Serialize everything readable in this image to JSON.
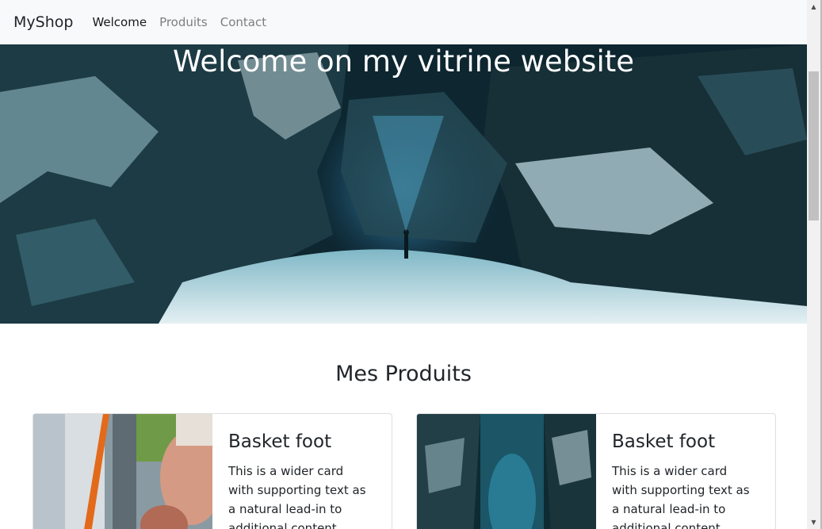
{
  "navbar": {
    "brand": "MyShop",
    "links": [
      {
        "label": "Welcome",
        "active": true
      },
      {
        "label": "Produits",
        "active": false
      },
      {
        "label": "Contact",
        "active": false
      }
    ]
  },
  "hero": {
    "title": "Welcome on my vitrine website"
  },
  "products": {
    "heading": "Mes Produits",
    "cards": [
      {
        "title": "Basket foot",
        "text": "This is a wider card with supporting text as a natural lead-in to additional content."
      },
      {
        "title": "Basket foot",
        "text": "This is a wider card with supporting text as a natural lead-in to additional content."
      }
    ]
  },
  "scrollbar": {
    "up_icon": "arrow-up-icon",
    "down_icon": "arrow-down-icon"
  }
}
